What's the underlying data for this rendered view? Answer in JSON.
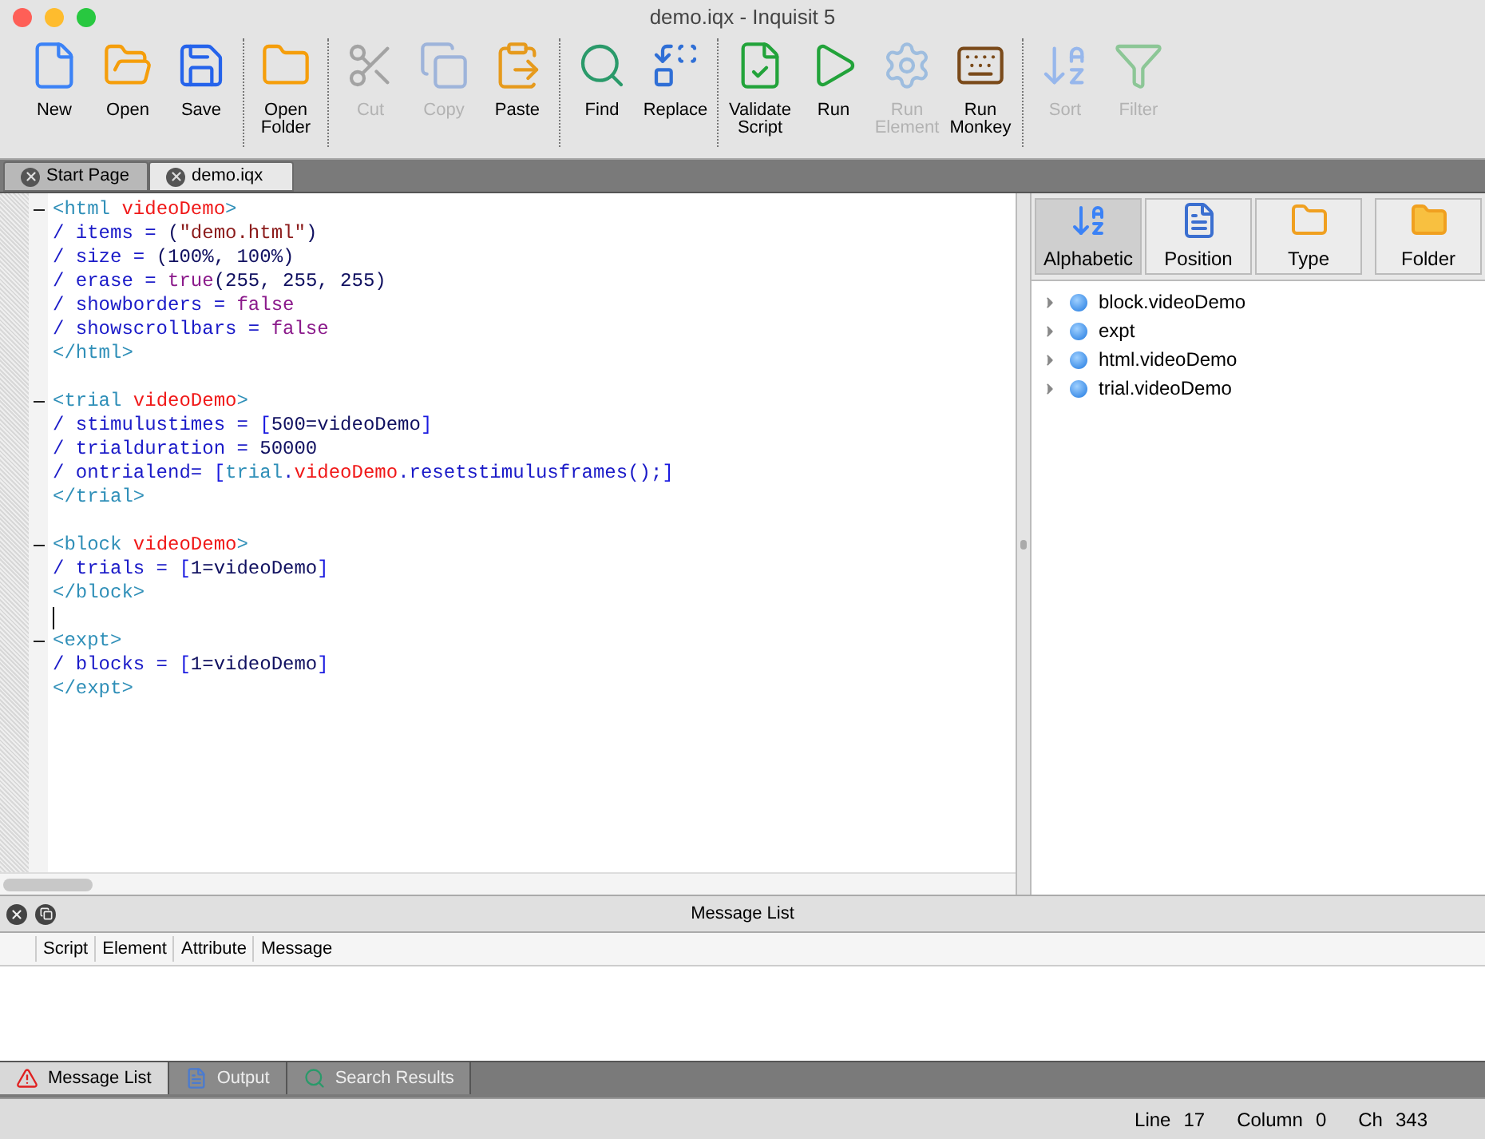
{
  "window": {
    "title": "demo.iqx - Inquisit 5"
  },
  "toolbar": [
    [
      {
        "label": "New",
        "disabled": false
      },
      {
        "label": "Open",
        "disabled": false
      },
      {
        "label": "Save",
        "disabled": false
      }
    ],
    [
      {
        "label": "Open\nFolder",
        "disabled": false
      }
    ],
    [
      {
        "label": "Cut",
        "disabled": true
      },
      {
        "label": "Copy",
        "disabled": true
      },
      {
        "label": "Paste",
        "disabled": false
      }
    ],
    [
      {
        "label": "Find",
        "disabled": false
      },
      {
        "label": "Replace",
        "disabled": false
      }
    ],
    [
      {
        "label": "Validate\nScript",
        "disabled": false
      },
      {
        "label": "Run",
        "disabled": false
      },
      {
        "label": "Run\nElement",
        "disabled": true
      },
      {
        "label": "Run\nMonkey",
        "disabled": false
      }
    ],
    [
      {
        "label": "Sort",
        "disabled": true
      },
      {
        "label": "Filter",
        "disabled": true
      }
    ]
  ],
  "document_tabs": [
    {
      "label": "Start Page",
      "selected": false
    },
    {
      "label": "demo.iqx",
      "selected": true
    }
  ],
  "editor": {
    "lines": [
      {
        "fold": true,
        "tokens": [
          {
            "kind": "tag",
            "text": "<html "
          },
          {
            "kind": "name",
            "text": "videoDemo"
          },
          {
            "kind": "tag",
            "text": ">"
          }
        ]
      },
      {
        "fold": false,
        "tokens": [
          {
            "kind": "attr",
            "text": "/ items = "
          },
          {
            "kind": "plain",
            "text": "("
          },
          {
            "kind": "string",
            "text": "\"demo.html\""
          },
          {
            "kind": "plain",
            "text": ")"
          }
        ]
      },
      {
        "fold": false,
        "tokens": [
          {
            "kind": "attr",
            "text": "/ size = "
          },
          {
            "kind": "plain",
            "text": "(100%, 100%)"
          }
        ]
      },
      {
        "fold": false,
        "tokens": [
          {
            "kind": "attr",
            "text": "/ erase = "
          },
          {
            "kind": "keyword",
            "text": "true"
          },
          {
            "kind": "plain",
            "text": "(255, 255, 255)"
          }
        ]
      },
      {
        "fold": false,
        "tokens": [
          {
            "kind": "attr",
            "text": "/ showborders = "
          },
          {
            "kind": "keyword",
            "text": "false"
          }
        ]
      },
      {
        "fold": false,
        "tokens": [
          {
            "kind": "attr",
            "text": "/ showscrollbars = "
          },
          {
            "kind": "keyword",
            "text": "false"
          }
        ]
      },
      {
        "fold": false,
        "tokens": [
          {
            "kind": "tag",
            "text": "</html>"
          }
        ]
      },
      {
        "fold": false
      },
      {
        "fold": true,
        "tokens": [
          {
            "kind": "tag",
            "text": "<trial "
          },
          {
            "kind": "name",
            "text": "videoDemo"
          },
          {
            "kind": "tag",
            "text": ">"
          }
        ]
      },
      {
        "fold": false,
        "tokens": [
          {
            "kind": "attr",
            "text": "/ stimulustimes = "
          },
          {
            "kind": "bracket",
            "text": "["
          },
          {
            "kind": "plain",
            "text": "500=videoDemo"
          },
          {
            "kind": "bracket",
            "text": "]"
          }
        ]
      },
      {
        "fold": false,
        "tokens": [
          {
            "kind": "attr",
            "text": "/ trialduration = "
          },
          {
            "kind": "plain",
            "text": "50000"
          }
        ]
      },
      {
        "fold": false,
        "tokens": [
          {
            "kind": "attr",
            "text": "/ ontrialend= "
          },
          {
            "kind": "bracket",
            "text": "["
          },
          {
            "kind": "tag",
            "text": "trial"
          },
          {
            "kind": "attr",
            "text": "."
          },
          {
            "kind": "name",
            "text": "videoDemo"
          },
          {
            "kind": "attr",
            "text": ".resetstimulusframes();"
          },
          {
            "kind": "bracket",
            "text": "]"
          }
        ]
      },
      {
        "fold": false,
        "tokens": [
          {
            "kind": "tag",
            "text": "</trial>"
          }
        ]
      },
      {
        "fold": false
      },
      {
        "fold": true,
        "tokens": [
          {
            "kind": "tag",
            "text": "<block "
          },
          {
            "kind": "name",
            "text": "videoDemo"
          },
          {
            "kind": "tag",
            "text": ">"
          }
        ]
      },
      {
        "fold": false,
        "tokens": [
          {
            "kind": "attr",
            "text": "/ trials = "
          },
          {
            "kind": "bracket",
            "text": "["
          },
          {
            "kind": "plain",
            "text": "1=videoDemo"
          },
          {
            "kind": "bracket",
            "text": "]"
          }
        ]
      },
      {
        "fold": false,
        "tokens": [
          {
            "kind": "tag",
            "text": "</block>"
          }
        ]
      },
      {
        "fold": false,
        "cursor": true
      },
      {
        "fold": true,
        "tokens": [
          {
            "kind": "tag",
            "text": "<expt>"
          }
        ]
      },
      {
        "fold": false,
        "tokens": [
          {
            "kind": "attr",
            "text": "/ blocks = "
          },
          {
            "kind": "bracket",
            "text": "["
          },
          {
            "kind": "plain",
            "text": "1=videoDemo"
          },
          {
            "kind": "bracket",
            "text": "]"
          }
        ]
      },
      {
        "fold": false,
        "tokens": [
          {
            "kind": "tag",
            "text": "</expt>"
          }
        ]
      }
    ]
  },
  "element_panel": {
    "view_buttons": [
      {
        "label": "Alphabetic",
        "selected": true
      },
      {
        "label": "Position",
        "selected": false
      },
      {
        "label": "Type",
        "selected": false
      }
    ],
    "folder_button": {
      "label": "Folder"
    },
    "tree": [
      {
        "label": "block.videoDemo",
        "expanded": false
      },
      {
        "label": "expt",
        "expanded": false
      },
      {
        "label": "html.videoDemo",
        "expanded": false
      },
      {
        "label": "trial.videoDemo",
        "expanded": false
      }
    ]
  },
  "message_list": {
    "title": "Message List",
    "columns": [
      "Script",
      "Element",
      "Attribute",
      "Message"
    ]
  },
  "bottom_tabs": [
    {
      "label": "Message List",
      "selected": true
    },
    {
      "label": "Output",
      "selected": false
    },
    {
      "label": "Search Results",
      "selected": false
    }
  ],
  "status_bar": [
    {
      "label": "Line",
      "value": "17"
    },
    {
      "label": "Column",
      "value": "0"
    },
    {
      "label": "Ch",
      "value": "343"
    }
  ]
}
